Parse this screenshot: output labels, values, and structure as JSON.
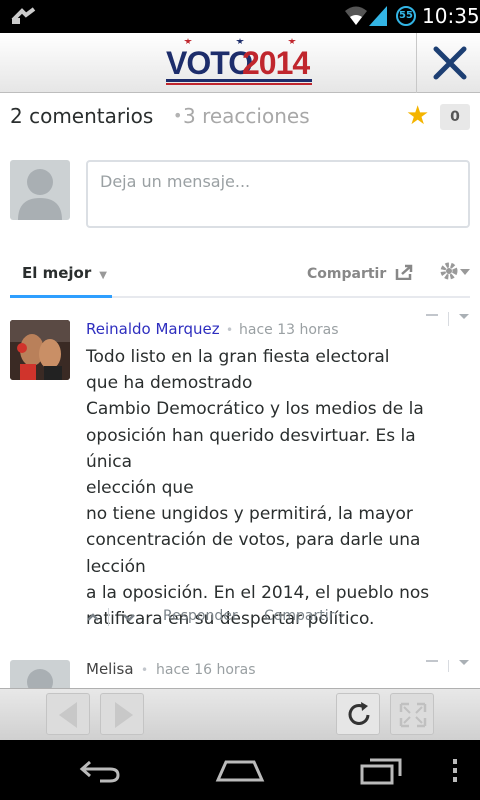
{
  "status_bar": {
    "time": "10:35",
    "notification_badge": "55"
  },
  "header": {
    "logo_word": "VOTO",
    "logo_year": "2014"
  },
  "counts": {
    "comments": "2 comentarios",
    "separator": "•",
    "reactions": "3 reacciones",
    "favorites": "0"
  },
  "composer": {
    "placeholder": "Deja un mensaje..."
  },
  "sort_tab": {
    "label": "El mejor",
    "share_label": "Compartir"
  },
  "comments": [
    {
      "author": "Reinaldo Marquez",
      "separator": "•",
      "time": "hace 13 horas",
      "lines": [
        "Todo listo en la gran fiesta electoral",
        "que ha demostrado",
        "Cambio Democrático y los medios de la",
        "oposición han querido desvirtuar. Es la única",
        "elección que",
        "no tiene ungidos y permitirá, la mayor",
        "concentración de votos, para darle una",
        "lección",
        "a la oposición. En el 2014, el pueblo nos",
        "ratificara en su despertar político."
      ],
      "reply_label": "Responder",
      "share_label": "Compartir ›"
    },
    {
      "author": "Melisa",
      "separator": "•",
      "time": "hace 16 horas"
    }
  ],
  "colors": {
    "accent": "#2e9fff",
    "author_link": "#2e2ebf",
    "logo_blue": "#1d2d6b",
    "logo_red": "#c0262d",
    "star": "#f4b400"
  }
}
